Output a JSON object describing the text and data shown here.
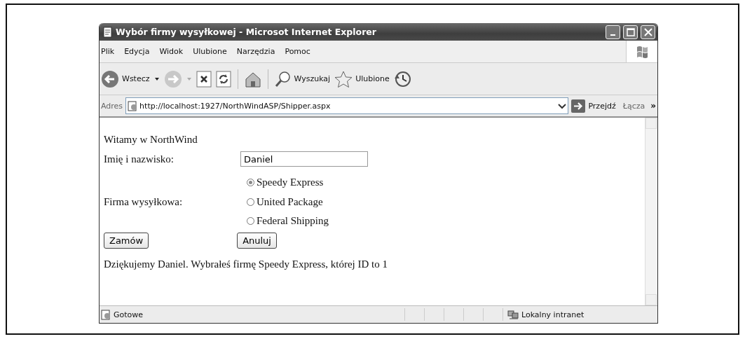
{
  "window": {
    "title": "Wybór firmy wysyłkowej - Microsot Internet Explorer"
  },
  "menu": [
    {
      "label": "Plik"
    },
    {
      "label": "Edycja"
    },
    {
      "label": "Widok"
    },
    {
      "label": "Ulubione"
    },
    {
      "label": "Narzędzia"
    },
    {
      "label": "Pomoc"
    }
  ],
  "toolbar": {
    "back": "Wstecz",
    "search": "Wyszukaj",
    "favorites": "Ulubione"
  },
  "address": {
    "label": "Adres",
    "url": "http://localhost:1927/NorthWindASP/Shipper.aspx",
    "go": "Przejdź",
    "links": "Łącza",
    "more": "»"
  },
  "page": {
    "heading": "Witamy w NorthWind",
    "name_label": "Imię i nazwisko:",
    "name_value": "Daniel",
    "shipper_label": "Firma wysyłkowa:",
    "shippers": [
      {
        "label": "Speedy Express",
        "selected": true
      },
      {
        "label": "United Package",
        "selected": false
      },
      {
        "label": "Federal Shipping",
        "selected": false
      }
    ],
    "buttons": [
      "Zamów",
      "Anuluj"
    ],
    "message": "Dziękujemy Daniel. Wybrałeś firmę Speedy Express, której ID to 1"
  },
  "status_bar": {
    "text": "Gotowe",
    "zone": "Lokalny intranet"
  }
}
